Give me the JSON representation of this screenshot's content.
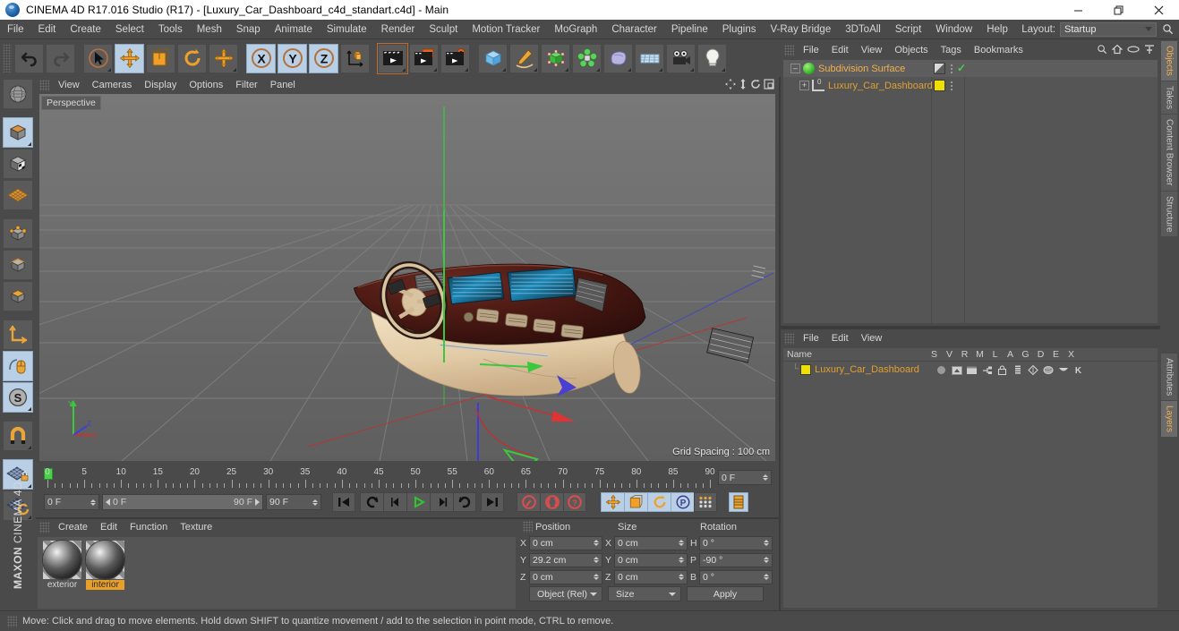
{
  "window": {
    "title": "CINEMA 4D R17.016 Studio (R17) - [Luxury_Car_Dashboard_c4d_standart.c4d] - Main",
    "app_icon": "c4d-logo-icon",
    "minimize": "minimize-icon",
    "maximize": "maximize-icon",
    "close": "close-icon"
  },
  "menubar": {
    "items": [
      "File",
      "Edit",
      "Create",
      "Select",
      "Tools",
      "Mesh",
      "Snap",
      "Animate",
      "Simulate",
      "Render",
      "Sculpt",
      "Motion Tracker",
      "MoGraph",
      "Character",
      "Pipeline",
      "Plugins",
      "V-Ray Bridge",
      "3DToAll",
      "Script",
      "Window",
      "Help"
    ],
    "layout_label": "Layout:",
    "layout_value": "Startup",
    "search_icon": "search-icon"
  },
  "toolbar": {
    "groups": [
      {
        "buttons": [
          {
            "name": "undo-button",
            "icon": "undo-arrow",
            "active": false
          },
          {
            "name": "redo-button",
            "icon": "redo-arrow",
            "active": false,
            "disabled": true
          }
        ]
      },
      {
        "buttons": [
          {
            "name": "live-selection-button",
            "icon": "cursor-circle",
            "active": false,
            "corner": true
          },
          {
            "name": "move-tool-button",
            "icon": "move-cross",
            "active": true
          },
          {
            "name": "scale-tool-button",
            "icon": "scale-square",
            "active": false
          },
          {
            "name": "rotate-tool-button",
            "icon": "rotate-circle",
            "active": false
          },
          {
            "name": "move-dynamic-button",
            "icon": "move-cross",
            "active": false,
            "corner": true
          }
        ]
      },
      {
        "buttons": [
          {
            "name": "axis-x-lock-button",
            "icon": "letter-x-circle",
            "active": true
          },
          {
            "name": "axis-y-lock-button",
            "icon": "letter-y-circle",
            "active": true
          },
          {
            "name": "axis-z-lock-button",
            "icon": "letter-z-circle",
            "active": true
          },
          {
            "name": "world-object-coordinates-button",
            "icon": "axis-cube",
            "active": false
          }
        ]
      },
      {
        "buttons": [
          {
            "name": "render-view-button",
            "icon": "clapperboard",
            "active": false,
            "corner": true
          },
          {
            "name": "render-to-picture-viewer-button",
            "icon": "clapperboard-window",
            "active": false,
            "corner": true
          },
          {
            "name": "render-settings-button",
            "icon": "clapperboard-gear",
            "active": false,
            "corner": true
          }
        ]
      },
      {
        "buttons": [
          {
            "name": "add-cube-object-button",
            "icon": "blue-cube",
            "active": false,
            "corner": true
          },
          {
            "name": "add-spline-button",
            "icon": "pen-spline",
            "active": false,
            "corner": true
          },
          {
            "name": "add-nurbs-button",
            "icon": "green-cube",
            "active": false,
            "corner": true
          },
          {
            "name": "add-array-button",
            "icon": "green-cluster",
            "active": false,
            "corner": true
          },
          {
            "name": "add-deformer-button",
            "icon": "bend-blob",
            "active": false,
            "corner": true
          },
          {
            "name": "add-environment-button",
            "icon": "floor-grid",
            "active": false,
            "corner": true
          },
          {
            "name": "add-camera-button",
            "icon": "camera",
            "active": false,
            "corner": true
          },
          {
            "name": "add-light-button",
            "icon": "light-bulb",
            "active": false,
            "corner": true
          }
        ]
      }
    ]
  },
  "left_toolbar": {
    "buttons": [
      {
        "name": "make-editable-button",
        "icon": "sphere-wire",
        "active": false
      },
      {
        "name": "model-mode-button",
        "icon": "cube-model",
        "active": true,
        "corner": true
      },
      {
        "name": "texture-mode-button",
        "icon": "cube-checker",
        "active": false
      },
      {
        "name": "workplane-mode-button",
        "icon": "orange-grid",
        "active": false
      },
      {
        "name": "points-mode-button",
        "icon": "cube-points",
        "active": false
      },
      {
        "name": "edges-mode-button",
        "icon": "cube-edges",
        "active": false
      },
      {
        "name": "polygons-mode-button",
        "icon": "cube-polygons",
        "active": false
      },
      {
        "name": "object-axis-mode-button",
        "icon": "axis-l",
        "active": false
      },
      {
        "name": "enable-axis-modification-button",
        "icon": "mouse-axis",
        "active": true
      },
      {
        "name": "enable-snap-button",
        "icon": "letter-s-circle",
        "active": true,
        "corner": true
      },
      {
        "name": "magnet-tool-button",
        "icon": "magnet",
        "active": false,
        "corner": true
      },
      {
        "name": "workplane-lock-button",
        "icon": "grid-lock",
        "active": true,
        "corner": true
      },
      {
        "name": "workplane-rotate-button",
        "icon": "grid-rotate",
        "active": false,
        "corner": true
      }
    ],
    "brand_bold": "MAXON",
    "brand_thin": "CINEMA 4D"
  },
  "viewport": {
    "menu_items": [
      "View",
      "Cameras",
      "Display",
      "Options",
      "Filter",
      "Panel"
    ],
    "corner_icons": [
      "pan-icon",
      "dolly-icon",
      "rotate-icon",
      "maximize-view-icon"
    ],
    "label": "Perspective",
    "grid_spacing": "Grid Spacing : 100 cm",
    "axis_gizmo": {
      "y": "Y",
      "x": "X",
      "z": "Z"
    }
  },
  "timeline": {
    "tick_labels": [
      "0",
      "5",
      "10",
      "15",
      "20",
      "25",
      "30",
      "35",
      "40",
      "45",
      "50",
      "55",
      "60",
      "65",
      "70",
      "75",
      "80",
      "85",
      "90"
    ],
    "current_frame_right": "0 F",
    "current_frame": "0 F",
    "range_start": "0 F",
    "range_end": "90 F",
    "max_frame": "90 F",
    "buttons": [
      {
        "name": "go-to-start-button",
        "icon": "skip-start"
      },
      {
        "name": "play-backwards-button",
        "icon": "loop-back"
      },
      {
        "name": "previous-frame-button",
        "icon": "step-back"
      },
      {
        "name": "play-forwards-button",
        "icon": "play"
      },
      {
        "name": "next-frame-button",
        "icon": "step-forward"
      },
      {
        "name": "loop-button",
        "icon": "loop-forward"
      },
      {
        "name": "go-to-end-button",
        "icon": "skip-end"
      },
      {
        "name": "record-active-objects-button",
        "icon": "record-key"
      },
      {
        "name": "autokeying-button",
        "icon": "autokey"
      },
      {
        "name": "keyframe-selection-button",
        "icon": "question-key"
      },
      {
        "name": "position-key-button",
        "icon": "move-cross",
        "active": true
      },
      {
        "name": "scale-key-button",
        "icon": "scale-square",
        "active": true
      },
      {
        "name": "rotation-key-button",
        "icon": "rotate-circle",
        "active": true
      },
      {
        "name": "parameter-key-button",
        "icon": "letter-p-circle",
        "active": true
      },
      {
        "name": "point-level-animation-button",
        "icon": "dots-grid",
        "active": false
      },
      {
        "name": "timeline-view-button",
        "icon": "timeline-bars",
        "active": true
      }
    ]
  },
  "material_manager": {
    "menu_items": [
      "Create",
      "Edit",
      "Function",
      "Texture"
    ],
    "materials": [
      {
        "name": "exterior",
        "selected": false
      },
      {
        "name": "interior",
        "selected": true
      }
    ]
  },
  "coordinates": {
    "headers": [
      "Position",
      "Size",
      "Rotation"
    ],
    "position": {
      "labels": [
        "X",
        "Y",
        "Z"
      ],
      "values": [
        "0 cm",
        "29.2 cm",
        "0 cm"
      ]
    },
    "size": {
      "labels": [
        "X",
        "Y",
        "Z"
      ],
      "values": [
        "0 cm",
        "0 cm",
        "0 cm"
      ]
    },
    "rotation": {
      "labels": [
        "H",
        "P",
        "B"
      ],
      "values": [
        "0 °",
        "-90 °",
        "0 °"
      ]
    },
    "mode_value": "Object (Rel)",
    "size_value": "Size",
    "apply_label": "Apply"
  },
  "object_manager": {
    "menu_items": [
      "File",
      "Edit",
      "View",
      "Objects",
      "Tags",
      "Bookmarks"
    ],
    "head_icons": [
      "search-icon",
      "home-icon",
      "link-icon",
      "expand-icon"
    ],
    "rows": [
      {
        "name": "Subdivision Surface",
        "icon": "subdivision-surface-icon",
        "indent": 0,
        "selected": true,
        "tags": [
          "tag-gray",
          "dots",
          "check"
        ]
      },
      {
        "name": "Luxury_Car_Dashboard",
        "icon": "null-object-icon",
        "indent": 1,
        "selected": false,
        "tags": [
          "tag-yellow",
          "dots"
        ]
      }
    ]
  },
  "layer_manager": {
    "menu_items": [
      "File",
      "Edit",
      "View"
    ],
    "columns": [
      "Name",
      "S",
      "V",
      "R",
      "M",
      "L",
      "A",
      "G",
      "D",
      "E",
      "X"
    ],
    "rows": [
      {
        "name": "Luxury_Car_Dashboard",
        "color": "#f0e000"
      }
    ]
  },
  "vertical_tabs": {
    "top": [
      {
        "label": "Objects",
        "active": true
      },
      {
        "label": "Takes",
        "active": false
      },
      {
        "label": "Content Browser",
        "active": false
      },
      {
        "label": "Structure",
        "active": false
      }
    ],
    "bottom": [
      {
        "label": "Attributes",
        "active": false
      },
      {
        "label": "Layers",
        "active": true
      }
    ]
  },
  "statusbar": {
    "text": "Move: Click and drag to move elements. Hold down SHIFT to quantize movement / add to the selection in point mode, CTRL to remove."
  },
  "colors": {
    "accent_orange": "#e0a030",
    "panel_bg": "#4a4a4a",
    "field_bg": "#5a5a5a",
    "active_blue": "#b9cfe6",
    "viewport_bg": "#6b6b6b",
    "title_bg": "#ffffff"
  }
}
